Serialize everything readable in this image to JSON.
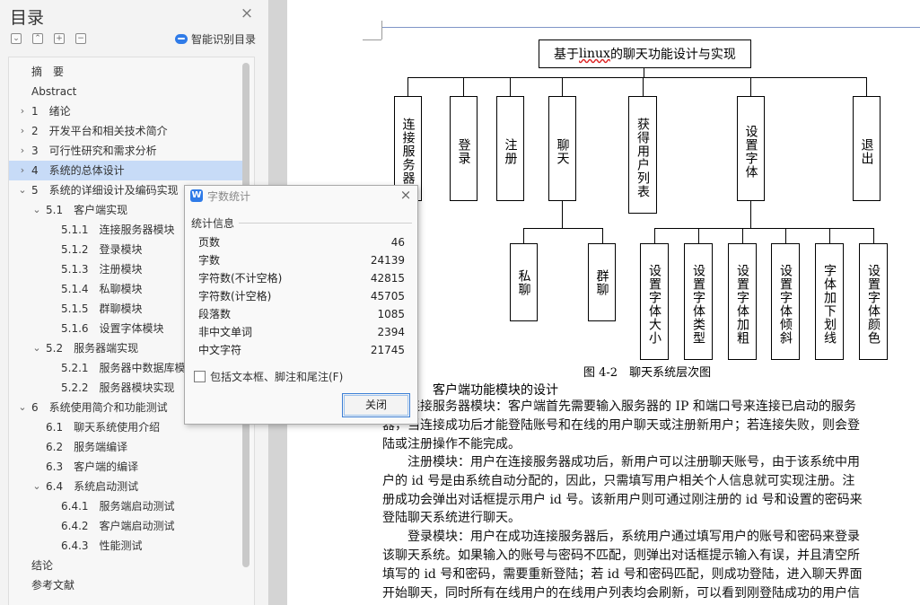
{
  "sidebar": {
    "title": "目录",
    "close_icon": "×",
    "toolbar_icons": [
      "collapse-all-icon",
      "expand-all-icon",
      "add-heading-icon",
      "remove-heading-icon"
    ],
    "smart_toc_label": "智能识别目录",
    "items": [
      {
        "label": "摘　要",
        "arrow": ""
      },
      {
        "label": "Abstract",
        "arrow": ""
      },
      {
        "label": "1　绪论",
        "arrow": "›"
      },
      {
        "label": "2　开发平台和相关技术简介",
        "arrow": "›"
      },
      {
        "label": "3　可行性研究和需求分析",
        "arrow": "›"
      },
      {
        "label": "4　系统的总体设计",
        "arrow": "›"
      },
      {
        "label": "5　系统的详细设计及编码实现",
        "arrow": "⌄"
      },
      {
        "label": "5.1　客户端实现",
        "arrow": "⌄"
      },
      {
        "label": "5.1.1　连接服务器模块",
        "arrow": ""
      },
      {
        "label": "5.1.2　登录模块",
        "arrow": ""
      },
      {
        "label": "5.1.3　注册模块",
        "arrow": ""
      },
      {
        "label": "5.1.4　私聊模块",
        "arrow": ""
      },
      {
        "label": "5.1.5　群聊模块",
        "arrow": ""
      },
      {
        "label": "5.1.6　设置字体模块",
        "arrow": ""
      },
      {
        "label": "5.2　服务器端实现",
        "arrow": "⌄"
      },
      {
        "label": "5.2.1　服务器中数据库模块",
        "arrow": ""
      },
      {
        "label": "5.2.2　服务器模块实现",
        "arrow": ""
      },
      {
        "label": "6　系统使用简介和功能测试",
        "arrow": "⌄"
      },
      {
        "label": "6.1　聊天系统使用介绍",
        "arrow": ""
      },
      {
        "label": "6.2　服务端编译",
        "arrow": ""
      },
      {
        "label": "6.3　客户端的编译",
        "arrow": ""
      },
      {
        "label": "6.4　系统启动测试",
        "arrow": "⌄"
      },
      {
        "label": "6.4.1　服务端启动测试",
        "arrow": ""
      },
      {
        "label": "6.4.2　客户端启动测试",
        "arrow": ""
      },
      {
        "label": "6.4.3　性能测试",
        "arrow": ""
      },
      {
        "label": "结论",
        "arrow": ""
      },
      {
        "label": "参考文献",
        "arrow": ""
      }
    ]
  },
  "document": {
    "diagram": {
      "root": {
        "prefix": "基于 ",
        "underlined": "linux",
        "suffix": " 的聊天功能设计与实现"
      },
      "level1": [
        "连接服务器",
        "登录",
        "注册",
        "聊天",
        "获得用户列表",
        "设置字体",
        "退出"
      ],
      "chat_children": [
        "私聊",
        "群聊"
      ],
      "font_children": [
        "设置字体大小",
        "设置字体类型",
        "设置字体加粗",
        "设置字体倾斜",
        "字体加下划线",
        "设置字体颜色"
      ]
    },
    "figure_caption": "图 4-2　聊天系统层次图",
    "section_heading": "客户端功能模块的设计",
    "paragraph_lines": [
      "连接服务器模块：客户端首先需要输入服务器的 IP 和端口号来连接已启动的服务",
      "器，当连接成功后才能登陆账号和在线的用户聊天或注册新用户；若连接失败，则会登",
      "陆或注册操作不能完成。",
      "　　注册模块：用户在连接服务器成功后，新用户可以注册聊天账号，由于该系统中用",
      "户的 id 号是由系统自动分配的，因此，只需填写用户相关个人信息就可实现注册。注",
      "册成功会弹出对话框提示用户 id 号。该新用户则可通过刚注册的 id 号和设置的密码来",
      "登陆聊天系统进行聊天。",
      "　　登录模块：用户在成功连接服务器后，系统用户通过填写用户的账号和密码来登录",
      "该聊天系统。如果输入的账号与密码不匹配，则弹出对话框提示输入有误，并且清空所",
      "填写的 id 号和密码，需要重新登陆；若 id 号和密码匹配，则成功登陆，进入聊天界面",
      "开始聊天，同时所有在线用户的在线用户列表均会刷新，可以看到刚登陆成功的用户信"
    ]
  },
  "dialog": {
    "title": "字数统计",
    "close_icon": "×",
    "group_label": "统计信息",
    "stats": [
      {
        "label": "页数",
        "value": "46"
      },
      {
        "label": "字数",
        "value": "24139"
      },
      {
        "label": "字符数(不计空格)",
        "value": "42815"
      },
      {
        "label": "字符数(计空格)",
        "value": "45705"
      },
      {
        "label": "段落数",
        "value": "1085"
      },
      {
        "label": "非中文单词",
        "value": "2394"
      },
      {
        "label": "中文字符",
        "value": "21745"
      }
    ],
    "include_label": "包括文本框、脚注和尾注(F)",
    "include_checked": false,
    "close_button_label": "关闭"
  }
}
